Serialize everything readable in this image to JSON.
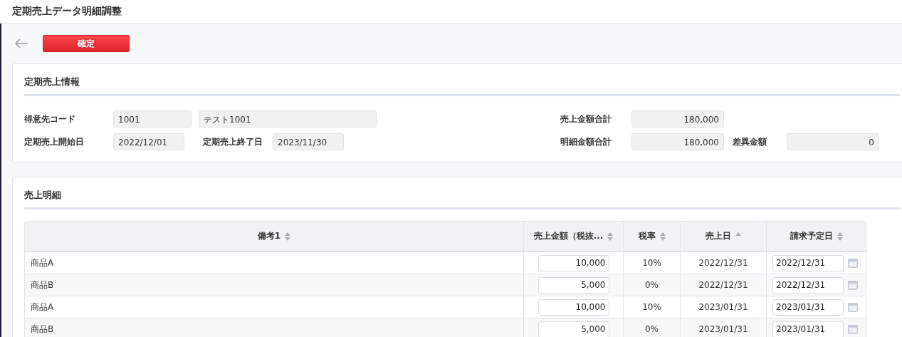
{
  "window": {
    "title": "定期売上データ明細調整"
  },
  "toolbar": {
    "confirm_button": "確定"
  },
  "info": {
    "heading": "定期売上情報",
    "customer_code": {
      "label": "得意先コード",
      "value": "1001",
      "name_value": "テスト1001"
    },
    "start_date": {
      "label": "定期売上開始日",
      "value": "2022/12/01"
    },
    "end_date": {
      "label": "定期売上終了日",
      "value": "2023/11/30"
    },
    "sales_total": {
      "label": "売上金額合計",
      "value": "180,000"
    },
    "detail_total": {
      "label": "明細金額合計",
      "value": "180,000"
    },
    "difference": {
      "label": "差異金額",
      "value": "0"
    }
  },
  "details": {
    "heading": "売上明細",
    "columns": [
      {
        "label": "備考1",
        "sorted": false
      },
      {
        "label": "売上金額（税抜...",
        "sorted": false
      },
      {
        "label": "税率",
        "sorted": false
      },
      {
        "label": "売上日",
        "sorted": true
      },
      {
        "label": "請求予定日",
        "sorted": false
      }
    ],
    "rows": [
      {
        "note": "商品A",
        "amount": "10,000",
        "tax": "10%",
        "sales_date": "2022/12/31",
        "billing_date": "2022/12/31"
      },
      {
        "note": "商品B",
        "amount": "5,000",
        "tax": "0%",
        "sales_date": "2022/12/31",
        "billing_date": "2022/12/31"
      },
      {
        "note": "商品A",
        "amount": "10,000",
        "tax": "10%",
        "sales_date": "2023/01/31",
        "billing_date": "2023/01/31"
      },
      {
        "note": "商品B",
        "amount": "5,000",
        "tax": "0%",
        "sales_date": "2023/01/31",
        "billing_date": "2023/01/31"
      }
    ]
  }
}
